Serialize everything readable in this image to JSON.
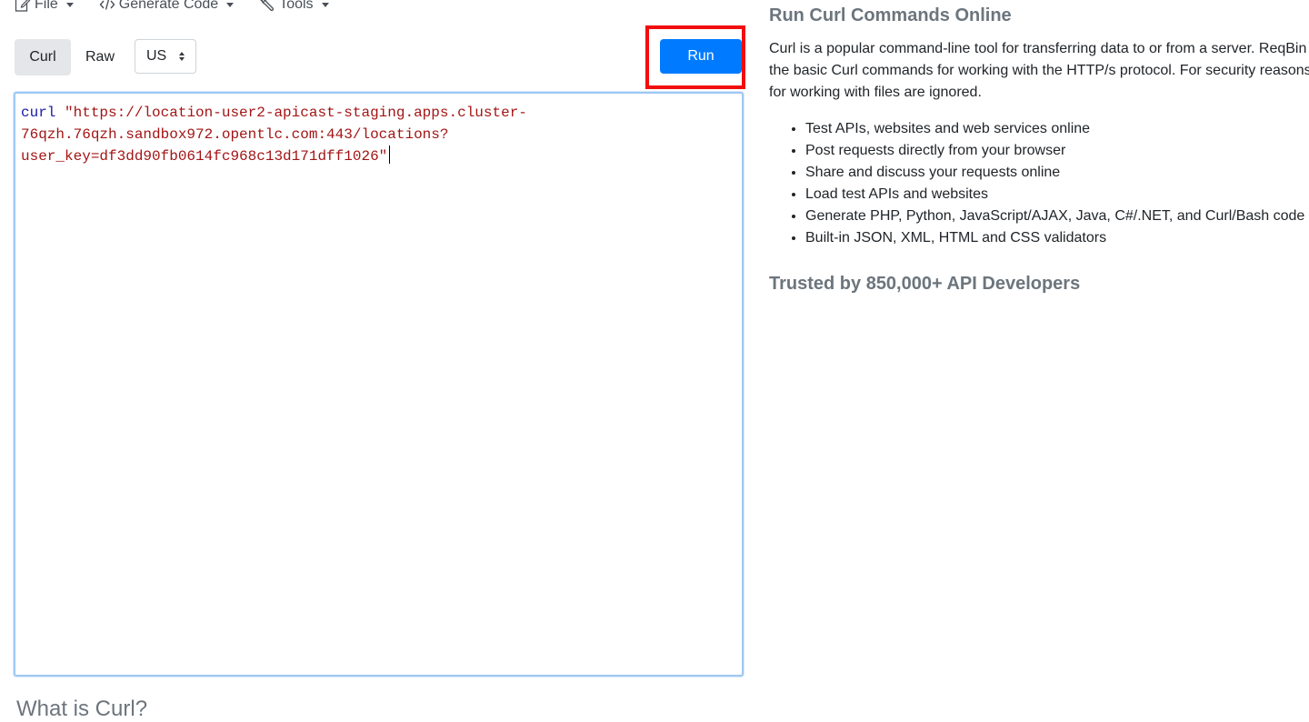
{
  "menu": {
    "file_label": "File",
    "generate_code_label": "Generate Code",
    "tools_label": "Tools"
  },
  "toolbar": {
    "curl_tab": "Curl",
    "raw_tab": "Raw",
    "region_selected": "US",
    "run_label": "Run"
  },
  "editor": {
    "command_keyword": "curl",
    "line1_url": "\"https://location-user2-apicast-staging.apps.cluster-",
    "line2_url": "76qzh.76qzh.sandbox972.opentlc.com:443/locations?",
    "line3_url": "user_key=df3dd90fb0614fc968c13d171dff1026\""
  },
  "below_editor_heading": "What is Curl?",
  "sidebar": {
    "title": "Run Curl Commands Online",
    "description_lines": [
      "Curl is a popular command-line tool for transferring data to or from a server. ReqBin",
      "the basic Curl commands for working with the HTTP/s protocol. For security reasons",
      "for working with files are ignored."
    ],
    "features": [
      "Test APIs, websites and web services online",
      "Post requests directly from your browser",
      "Share and discuss your requests online",
      "Load test APIs and websites",
      "Generate PHP, Python, JavaScript/AJAX, Java, C#/.NET, and Curl/Bash code",
      "Built-in JSON, XML, HTML and CSS validators"
    ],
    "trusted_text": "Trusted by 850,000+ API Developers"
  },
  "colors": {
    "run_button": "#007bff",
    "highlight_box": "#f20d0d",
    "keyword": "#1a1aa6",
    "string": "#a31515"
  }
}
